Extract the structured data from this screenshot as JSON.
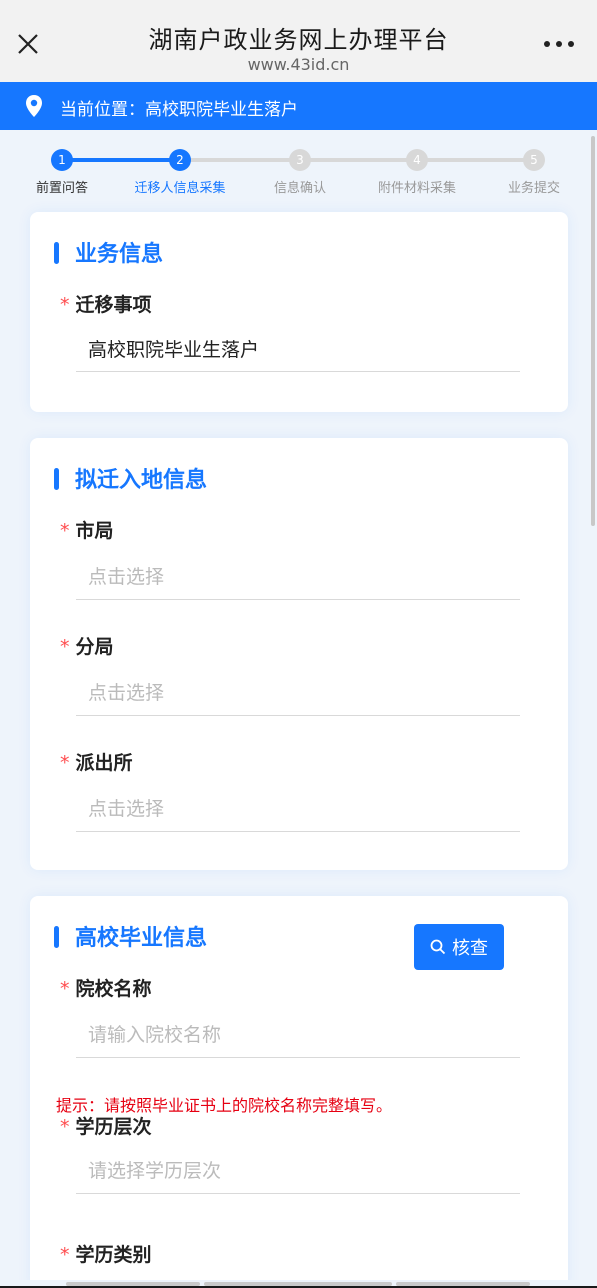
{
  "header": {
    "title": "湖南户政业务网上办理平台",
    "url": "www.43id.cn"
  },
  "location": {
    "label": "当前位置：",
    "value": "高校职院毕业生落户"
  },
  "stepper": {
    "steps": [
      {
        "num": "1",
        "label": "前置问答",
        "state": "done"
      },
      {
        "num": "2",
        "label": "迁移人信息采集",
        "state": "current"
      },
      {
        "num": "3",
        "label": "信息确认",
        "state": "todo"
      },
      {
        "num": "4",
        "label": "附件材料采集",
        "state": "todo"
      },
      {
        "num": "5",
        "label": "业务提交",
        "state": "todo"
      }
    ]
  },
  "business": {
    "title": "业务信息",
    "field_label": "迁移事项",
    "field_value": "高校职院毕业生落户"
  },
  "destination": {
    "title": "拟迁入地信息",
    "city_label": "市局",
    "city_placeholder": "点击选择",
    "branch_label": "分局",
    "branch_placeholder": "点击选择",
    "station_label": "派出所",
    "station_placeholder": "点击选择"
  },
  "graduation": {
    "title": "高校毕业信息",
    "check_button": "核查",
    "school_label": "院校名称",
    "school_placeholder": "请输入院校名称",
    "hint": "提示：请按照毕业证书上的院校名称完整填写。",
    "degree_label": "学历层次",
    "degree_placeholder": "请选择学历层次",
    "category_label": "学历类别"
  },
  "colors": {
    "accent": "#1677ff",
    "required": "#ff4d4f",
    "hint": "#e60012"
  }
}
